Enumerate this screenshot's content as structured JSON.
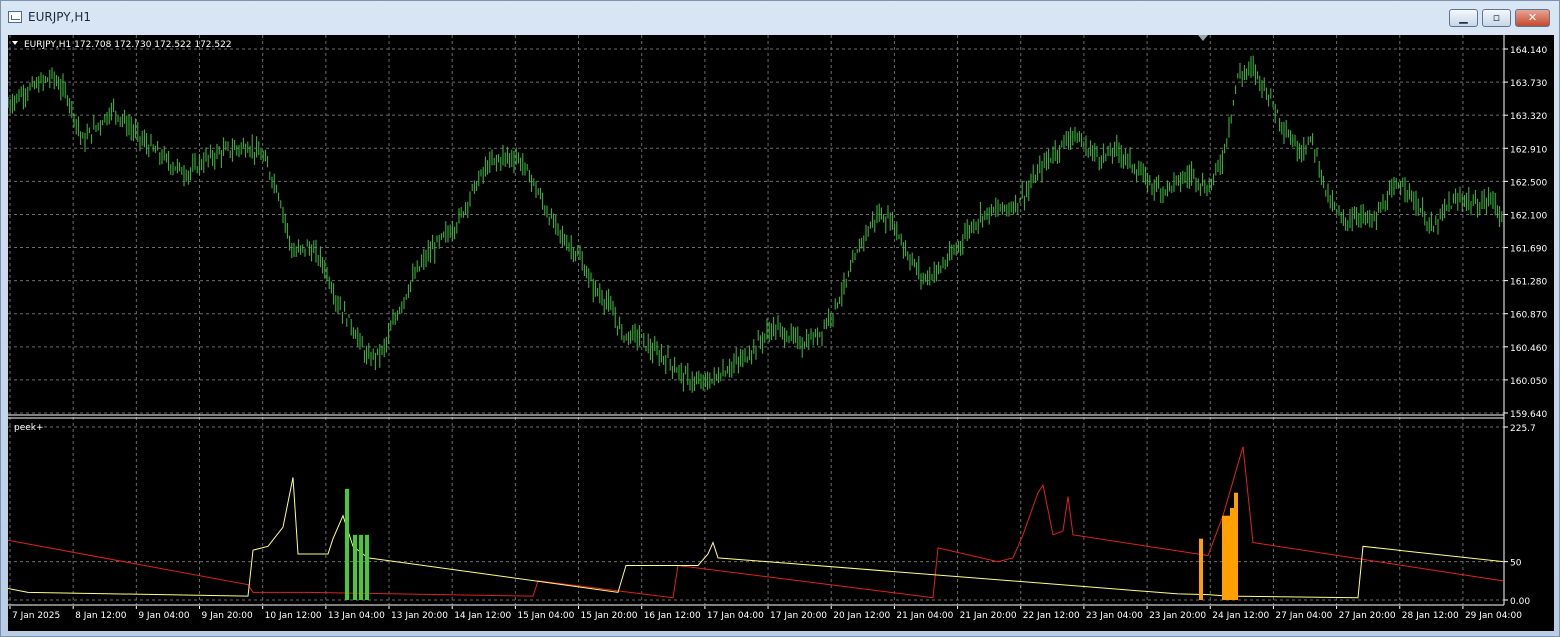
{
  "window": {
    "title": "EURJPY,H1",
    "buttons": {
      "minimize": "▁",
      "maximize": "▫",
      "close": "✕"
    }
  },
  "main_chart": {
    "symbol_info": "EURJPY,H1  172.708 172.730 172.522 172.522",
    "y_ticks": [
      "164.140",
      "163.730",
      "163.320",
      "162.910",
      "162.500",
      "162.100",
      "161.690",
      "161.280",
      "160.870",
      "160.460",
      "160.050",
      "159.640"
    ]
  },
  "indicator": {
    "name": "peek+",
    "y_ticks": [
      "225.7",
      "50",
      "0.00"
    ]
  },
  "x_ticks": [
    "7 Jan 2025",
    "8 Jan 12:00",
    "9 Jan 04:00",
    "9 Jan 20:00",
    "10 Jan 12:00",
    "13 Jan 04:00",
    "13 Jan 20:00",
    "14 Jan 12:00",
    "15 Jan 04:00",
    "15 Jan 20:00",
    "16 Jan 12:00",
    "17 Jan 04:00",
    "17 Jan 20:00",
    "20 Jan 12:00",
    "21 Jan 04:00",
    "21 Jan 20:00",
    "22 Jan 12:00",
    "23 Jan 04:00",
    "23 Jan 20:00",
    "24 Jan 12:00",
    "27 Jan 04:00",
    "27 Jan 20:00",
    "28 Jan 12:00",
    "29 Jan 04:00"
  ],
  "colors": {
    "candles": "#3fbf3f",
    "yellow_line": "#ffff7f",
    "red_line": "#e02020",
    "green_bars": "#44cc33",
    "orange_bars": "#ffa000",
    "grid": "#6b6b6b"
  },
  "chart_data": {
    "type": "line",
    "main": {
      "ylim": [
        159.64,
        164.14
      ],
      "close_path": [
        [
          0,
          163.45
        ],
        [
          15,
          163.6
        ],
        [
          30,
          163.7
        ],
        [
          45,
          163.8
        ],
        [
          60,
          163.55
        ],
        [
          75,
          163.0
        ],
        [
          90,
          163.2
        ],
        [
          105,
          163.4
        ],
        [
          120,
          163.2
        ],
        [
          135,
          163.0
        ],
        [
          150,
          162.85
        ],
        [
          165,
          162.7
        ],
        [
          180,
          162.6
        ],
        [
          195,
          162.75
        ],
        [
          210,
          162.85
        ],
        [
          225,
          162.9
        ],
        [
          240,
          162.95
        ],
        [
          255,
          162.8
        ],
        [
          270,
          162.4
        ],
        [
          285,
          161.6
        ],
        [
          300,
          161.7
        ],
        [
          315,
          161.5
        ],
        [
          330,
          161.0
        ],
        [
          345,
          160.7
        ],
        [
          360,
          160.3
        ],
        [
          375,
          160.4
        ],
        [
          390,
          160.9
        ],
        [
          405,
          161.3
        ],
        [
          420,
          161.6
        ],
        [
          435,
          161.8
        ],
        [
          450,
          162.0
        ],
        [
          465,
          162.4
        ],
        [
          480,
          162.7
        ],
        [
          495,
          162.8
        ],
        [
          510,
          162.8
        ],
        [
          525,
          162.5
        ],
        [
          540,
          162.1
        ],
        [
          555,
          161.8
        ],
        [
          570,
          161.6
        ],
        [
          585,
          161.2
        ],
        [
          600,
          161.0
        ],
        [
          615,
          160.6
        ],
        [
          630,
          160.6
        ],
        [
          645,
          160.4
        ],
        [
          660,
          160.3
        ],
        [
          675,
          160.1
        ],
        [
          690,
          160.0
        ],
        [
          705,
          160.05
        ],
        [
          720,
          160.2
        ],
        [
          735,
          160.3
        ],
        [
          750,
          160.5
        ],
        [
          765,
          160.7
        ],
        [
          780,
          160.6
        ],
        [
          795,
          160.5
        ],
        [
          810,
          160.6
        ],
        [
          825,
          160.9
        ],
        [
          840,
          161.3
        ],
        [
          855,
          161.8
        ],
        [
          870,
          162.1
        ],
        [
          885,
          162.0
        ],
        [
          900,
          161.6
        ],
        [
          915,
          161.3
        ],
        [
          930,
          161.4
        ],
        [
          945,
          161.6
        ],
        [
          960,
          161.9
        ],
        [
          975,
          162.1
        ],
        [
          990,
          162.15
        ],
        [
          1005,
          162.2
        ],
        [
          1020,
          162.4
        ],
        [
          1035,
          162.7
        ],
        [
          1050,
          162.9
        ],
        [
          1065,
          163.1
        ],
        [
          1080,
          162.9
        ],
        [
          1095,
          162.8
        ],
        [
          1110,
          162.9
        ],
        [
          1125,
          162.7
        ],
        [
          1140,
          162.5
        ],
        [
          1155,
          162.4
        ],
        [
          1170,
          162.5
        ],
        [
          1185,
          162.6
        ],
        [
          1200,
          162.4
        ],
        [
          1215,
          162.8
        ],
        [
          1230,
          163.8
        ],
        [
          1245,
          163.9
        ],
        [
          1260,
          163.6
        ],
        [
          1275,
          163.2
        ],
        [
          1290,
          162.9
        ],
        [
          1305,
          163.0
        ],
        [
          1320,
          162.3
        ],
        [
          1335,
          162.0
        ],
        [
          1350,
          162.1
        ],
        [
          1365,
          162.0
        ],
        [
          1380,
          162.3
        ],
        [
          1395,
          162.5
        ],
        [
          1410,
          162.2
        ],
        [
          1425,
          161.9
        ],
        [
          1440,
          162.2
        ],
        [
          1455,
          162.3
        ],
        [
          1470,
          162.2
        ],
        [
          1485,
          162.3
        ],
        [
          1495,
          162.0
        ]
      ],
      "series": [
        {
          "name": "EURJPY,H1",
          "values": "close_path"
        }
      ]
    },
    "indicator": {
      "ylim": [
        0,
        225.7
      ],
      "yellow": [
        [
          0,
          15
        ],
        [
          20,
          10
        ],
        [
          240,
          5
        ],
        [
          245,
          65
        ],
        [
          260,
          70
        ],
        [
          275,
          95
        ],
        [
          285,
          160
        ],
        [
          290,
          60
        ],
        [
          320,
          60
        ],
        [
          325,
          80
        ],
        [
          335,
          110
        ],
        [
          345,
          70
        ],
        [
          360,
          55
        ],
        [
          610,
          10
        ],
        [
          618,
          45
        ],
        [
          690,
          45
        ],
        [
          700,
          60
        ],
        [
          705,
          75
        ],
        [
          710,
          55
        ],
        [
          1170,
          8
        ],
        [
          1200,
          7
        ],
        [
          1220,
          5
        ],
        [
          1350,
          3
        ],
        [
          1355,
          70
        ],
        [
          1495,
          50
        ]
      ],
      "red": [
        [
          0,
          78
        ],
        [
          240,
          20
        ],
        [
          245,
          10
        ],
        [
          300,
          10
        ],
        [
          525,
          5
        ],
        [
          530,
          25
        ],
        [
          665,
          3
        ],
        [
          670,
          45
        ],
        [
          925,
          3
        ],
        [
          930,
          68
        ],
        [
          990,
          50
        ],
        [
          1005,
          55
        ],
        [
          1015,
          85
        ],
        [
          1030,
          140
        ],
        [
          1035,
          150
        ],
        [
          1045,
          85
        ],
        [
          1055,
          90
        ],
        [
          1060,
          135
        ],
        [
          1065,
          85
        ],
        [
          1190,
          60
        ],
        [
          1200,
          58
        ],
        [
          1215,
          110
        ],
        [
          1235,
          200
        ],
        [
          1245,
          75
        ],
        [
          1495,
          25
        ]
      ],
      "green_bars": [
        [
          337,
          145
        ],
        [
          345,
          85
        ],
        [
          351,
          85
        ],
        [
          357,
          85
        ]
      ],
      "orange_bars": [
        [
          1191,
          80
        ],
        [
          1214,
          110
        ],
        [
          1218,
          110
        ],
        [
          1222,
          120
        ],
        [
          1226,
          140
        ]
      ]
    }
  }
}
